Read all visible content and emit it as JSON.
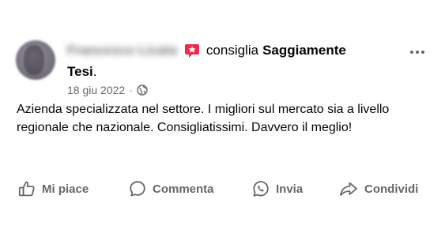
{
  "post": {
    "author_name": "Francesco Licata",
    "recommend_verb": "consiglia",
    "page_name_part1": "Saggiamente",
    "page_name_part2": "Tesi",
    "page_name_period": ".",
    "date": "18 giu 2022",
    "separator": "·",
    "privacy_icon": "globe-icon",
    "body": "Azienda specializzata nel settore. I migliori sul mercato sia a livello regionale che nazionale. Consigliatissimi. Davvero il meglio!",
    "recommend_icon_color": "#f02849"
  },
  "actions": {
    "like_label": "Mi piace",
    "comment_label": "Commenta",
    "send_label": "Invia",
    "share_label": "Condividi"
  },
  "colors": {
    "text_primary": "#050505",
    "text_secondary": "#65676b"
  }
}
